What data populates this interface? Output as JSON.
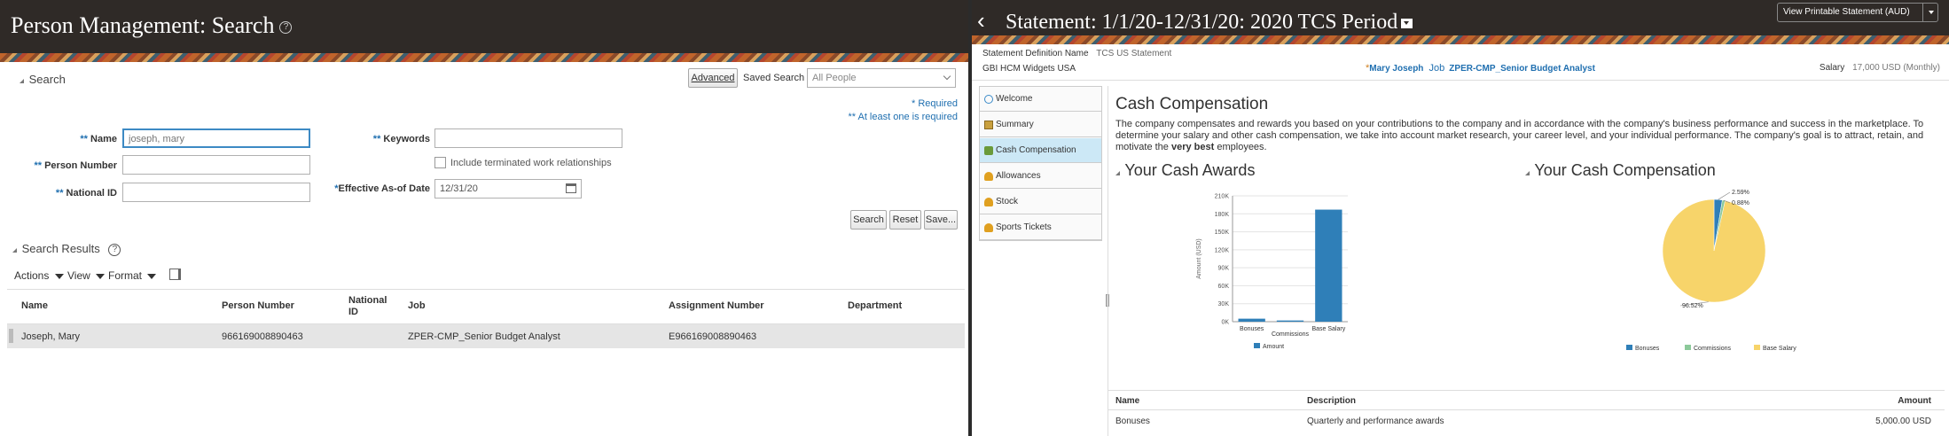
{
  "left": {
    "title": "Person Management: Search",
    "search_section": "Search",
    "advanced_label": "Advanced",
    "saved_search_label": "Saved Search",
    "saved_search_value": "All People",
    "required_note": "* Required",
    "at_least_one_note": "** At least one is required",
    "fields": {
      "name_label": "Name",
      "name_value": "joseph, mary",
      "person_number_label": "Person Number",
      "national_id_label": "National ID",
      "keywords_label": "Keywords",
      "include_terminated_label": "Include terminated work relationships",
      "effective_date_label": "Effective As-of Date",
      "effective_date_value": "12/31/20",
      "double_star": "**",
      "single_star": "*"
    },
    "buttons": {
      "search": "Search",
      "reset": "Reset",
      "save": "Save..."
    },
    "results_section": "Search Results",
    "toolbar": {
      "actions": "Actions",
      "view": "View",
      "format": "Format"
    },
    "columns": [
      "Name",
      "Person Number",
      "National ID",
      "Job",
      "Assignment Number",
      "Department"
    ],
    "rows": [
      [
        "Joseph, Mary",
        "966169008890463",
        "",
        "ZPER-CMP_Senior Budget Analyst",
        "E966169008890463",
        ""
      ]
    ]
  },
  "right": {
    "title": "Statement: 1/1/20-12/31/20: 2020 TCS Period",
    "view_printable": "View Printable Statement (AUD)",
    "statement_def_label": "Statement Definition Name",
    "statement_def_value": "TCS US Statement",
    "legal_entity": "GBI HCM Widgets USA",
    "person_name": "Mary Joseph",
    "job_label": "Job",
    "job_value": "ZPER-CMP_Senior Budget Analyst",
    "salary_label": "Salary",
    "salary_value": "17,000 USD (Monthly)",
    "nav": [
      {
        "label": "Welcome",
        "icon": "globe-icon"
      },
      {
        "label": "Summary",
        "icon": "summary-icon"
      },
      {
        "label": "Cash Compensation",
        "icon": "cash-icon"
      },
      {
        "label": "Allowances",
        "icon": "trophy-icon"
      },
      {
        "label": "Stock",
        "icon": "trophy-icon"
      },
      {
        "label": "Sports Tickets",
        "icon": "trophy-icon"
      }
    ],
    "section_title": "Cash Compensation",
    "intro": "The company compensates and rewards you based on your contributions to the company and in accordance with the company's business performance and success in the marketplace. To determine your salary and other cash compensation, we take into account market research, your career level, and your individual performance. The company's goal is to attract, retain, and motivate the",
    "intro_bold": "very best",
    "intro_end": "employees.",
    "cash_awards_title": "Your Cash Awards",
    "cash_comp_title": "Your Cash Compensation",
    "table": {
      "columns": [
        "Name",
        "Description",
        "Amount"
      ],
      "rows": [
        [
          "Bonuses",
          "Quarterly and performance awards",
          "5,000.00 USD"
        ]
      ]
    },
    "colors": {
      "blue": "#2f7fb8",
      "green": "#8cc99a",
      "yellow": "#f7d46a",
      "brand_header": "#2f2a27",
      "link": "#1f6fb0"
    }
  },
  "chart_data": [
    {
      "type": "bar",
      "title": "Your Cash Awards",
      "categories": [
        "Bonuses",
        "Commissions",
        "Base Salary"
      ],
      "series": [
        {
          "name": "Amount",
          "values": [
            5000,
            2000,
            187000
          ]
        }
      ],
      "ylabel": "Amount (USD)",
      "yticks": [
        "0K",
        "30K",
        "60K",
        "90K",
        "120K",
        "150K",
        "180K",
        "210K"
      ],
      "ylim": [
        0,
        210000
      ],
      "legend": "bottom"
    },
    {
      "type": "pie",
      "title": "Your Cash Compensation",
      "categories": [
        "Bonuses",
        "Commissions",
        "Base Salary"
      ],
      "values": [
        2.59,
        0.88,
        96.52
      ],
      "labels": [
        "2.59%",
        "0.88%",
        "96.52%"
      ],
      "legend": "bottom"
    }
  ]
}
